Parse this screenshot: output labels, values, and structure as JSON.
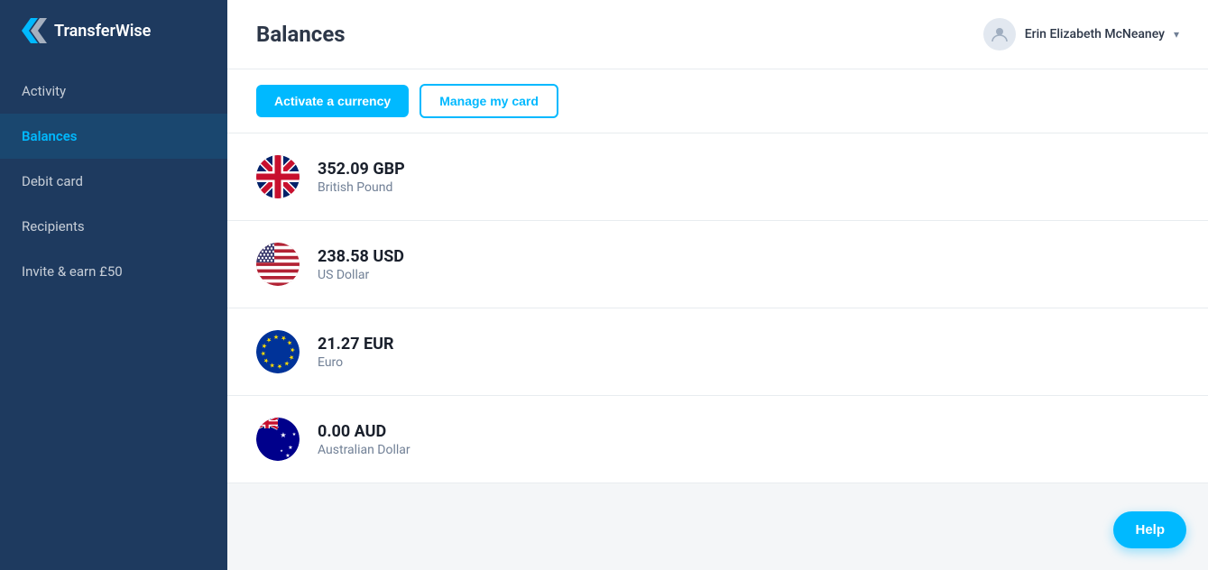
{
  "sidebar": {
    "logo_text": "TransferWise",
    "nav_items": [
      {
        "id": "activity",
        "label": "Activity",
        "active": false
      },
      {
        "id": "balances",
        "label": "Balances",
        "active": true
      },
      {
        "id": "debit-card",
        "label": "Debit card",
        "active": false
      },
      {
        "id": "recipients",
        "label": "Recipients",
        "active": false
      },
      {
        "id": "invite",
        "label": "Invite & earn £50",
        "active": false
      }
    ]
  },
  "header": {
    "page_title": "Balances",
    "user_name": "Erin Elizabeth McNeaney",
    "chevron": "▾"
  },
  "actions": {
    "activate_btn": "Activate a currency",
    "manage_btn": "Manage my card"
  },
  "balances": [
    {
      "amount": "352.09 GBP",
      "name": "British Pound",
      "flag": "🇬🇧",
      "code": "GBP"
    },
    {
      "amount": "238.58 USD",
      "name": "US Dollar",
      "flag": "🇺🇸",
      "code": "USD"
    },
    {
      "amount": "21.27 EUR",
      "name": "Euro",
      "flag": "🇪🇺",
      "code": "EUR"
    },
    {
      "amount": "0.00 AUD",
      "name": "Australian Dollar",
      "flag": "🇦🇺",
      "code": "AUD"
    }
  ],
  "help_button": "Help"
}
